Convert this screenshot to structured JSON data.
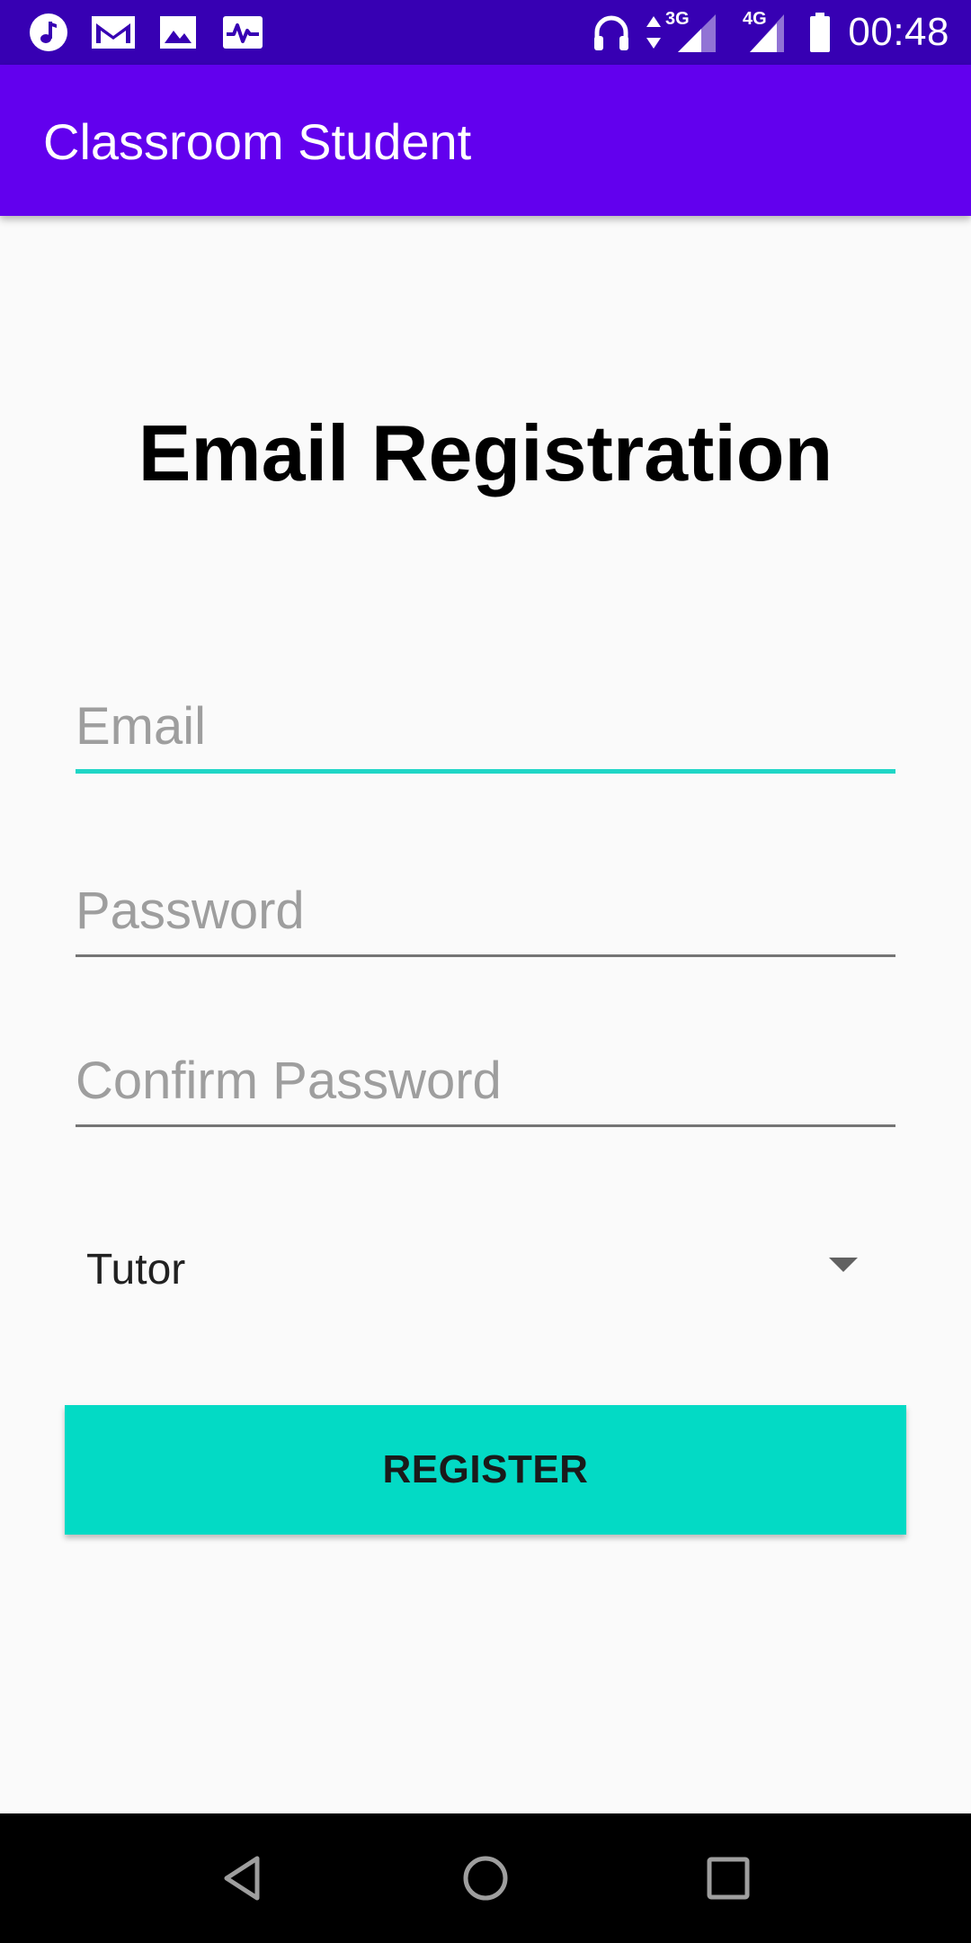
{
  "status_bar": {
    "time": "00:48",
    "icons": {
      "left": [
        "music-icon",
        "gmail-icon",
        "image-icon",
        "activity-icon"
      ],
      "right": [
        "headphones-icon",
        "data-arrows-icon",
        "signal-3g-icon",
        "signal-4g-icon",
        "battery-icon"
      ]
    },
    "network_3g_label": "3G",
    "network_4g_label": "4G"
  },
  "app_bar": {
    "title": "Classroom Student"
  },
  "form": {
    "heading": "Email Registration",
    "email": {
      "placeholder": "Email",
      "value": ""
    },
    "password": {
      "placeholder": "Password",
      "value": ""
    },
    "confirm_password": {
      "placeholder": "Confirm Password",
      "value": ""
    },
    "role_spinner": {
      "selected": "Tutor"
    },
    "register_label": "REGISTER"
  },
  "nav_bar": {
    "buttons": [
      "back",
      "home",
      "recents"
    ]
  },
  "colors": {
    "status_bar": "#3700b3",
    "app_bar": "#6200ee",
    "accent": "#03dac5",
    "focus_underline": "#1fd6c6",
    "background": "#fafafa"
  }
}
